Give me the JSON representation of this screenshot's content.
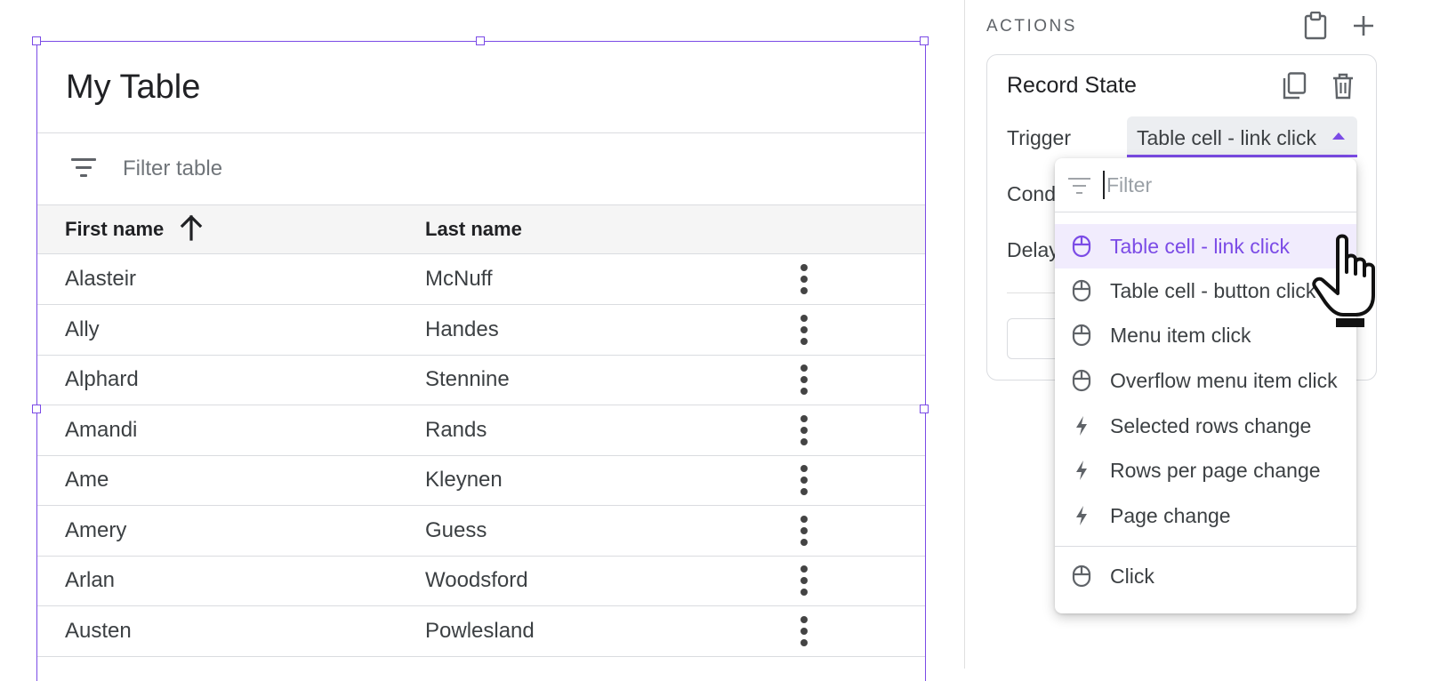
{
  "table": {
    "title": "My Table",
    "filter_placeholder": "Filter table",
    "columns": [
      "First name",
      "Last name"
    ],
    "rows": [
      {
        "first": "Alasteir",
        "last": "McNuff"
      },
      {
        "first": "Ally",
        "last": "Handes"
      },
      {
        "first": "Alphard",
        "last": "Stennine"
      },
      {
        "first": "Amandi",
        "last": "Rands"
      },
      {
        "first": "Ame",
        "last": "Kleynen"
      },
      {
        "first": "Amery",
        "last": "Guess"
      },
      {
        "first": "Arlan",
        "last": "Woodsford"
      },
      {
        "first": "Austen",
        "last": "Powlesland"
      }
    ]
  },
  "panel": {
    "section_label": "ACTIONS",
    "card": {
      "title": "Record State",
      "trigger_label": "Trigger",
      "trigger_value": "Table cell - link click",
      "condition_label": "Cond",
      "delay_label": "Delay"
    }
  },
  "menu": {
    "filter_placeholder": "Filter",
    "items": [
      {
        "label": "Table cell - link click",
        "icon": "mouse-icon",
        "selected": true
      },
      {
        "label": "Table cell - button click",
        "icon": "mouse-icon"
      },
      {
        "label": "Menu item click",
        "icon": "mouse-icon"
      },
      {
        "label": "Overflow menu item click",
        "icon": "mouse-icon"
      },
      {
        "label": "Selected rows change",
        "icon": "bolt-icon"
      },
      {
        "label": "Rows per page change",
        "icon": "bolt-icon"
      },
      {
        "label": "Page change",
        "icon": "bolt-icon"
      },
      {
        "label": "Click",
        "icon": "mouse-icon"
      }
    ]
  },
  "colors": {
    "accent": "#7b4be6",
    "selected_bg": "#f1ecfd"
  }
}
